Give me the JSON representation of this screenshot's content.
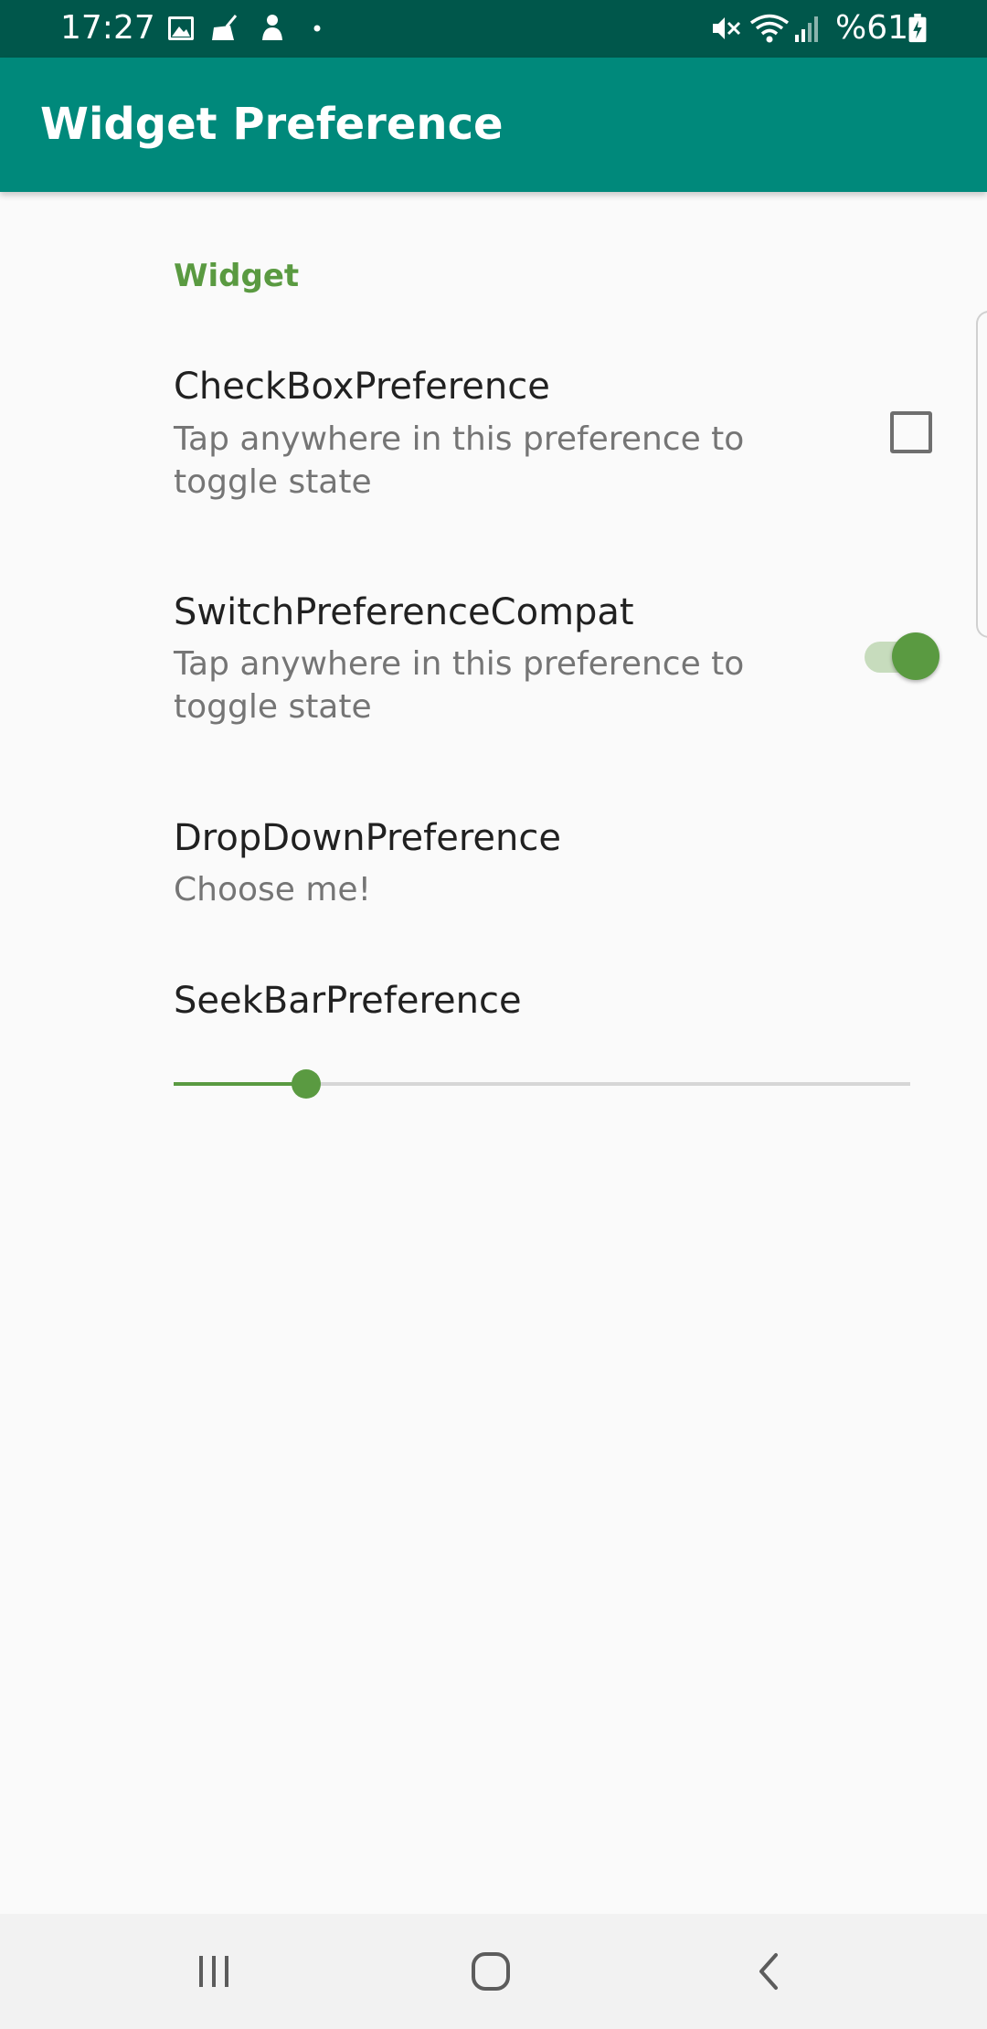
{
  "status_bar": {
    "time": "17:27",
    "battery_percent": "%61",
    "icons": [
      "image-icon",
      "cleaner-icon",
      "notification-icon",
      "dot-icon",
      "mute-icon",
      "wifi-icon",
      "signal-icon",
      "battery-charging-icon"
    ]
  },
  "app_bar": {
    "title": "Widget Preference"
  },
  "preferences": {
    "category": "Widget",
    "checkbox": {
      "title": "CheckBoxPreference",
      "summary": "Tap anywhere in this preference to toggle state",
      "checked": false
    },
    "switch": {
      "title": "SwitchPreferenceCompat",
      "summary": "Tap anywhere in this preference to toggle state",
      "on": true
    },
    "dropdown": {
      "title": "DropDownPreference",
      "summary": "Choose me!"
    },
    "seekbar": {
      "title": "SeekBarPreference",
      "progress": 0.18
    }
  },
  "nav_bar": {
    "icons": [
      "recent-apps-icon",
      "home-icon",
      "back-icon"
    ]
  },
  "colors": {
    "status_bar": "#00574b",
    "app_bar": "#00897b",
    "accent": "#5a9a41",
    "switch_track": "#c7dcbd"
  }
}
